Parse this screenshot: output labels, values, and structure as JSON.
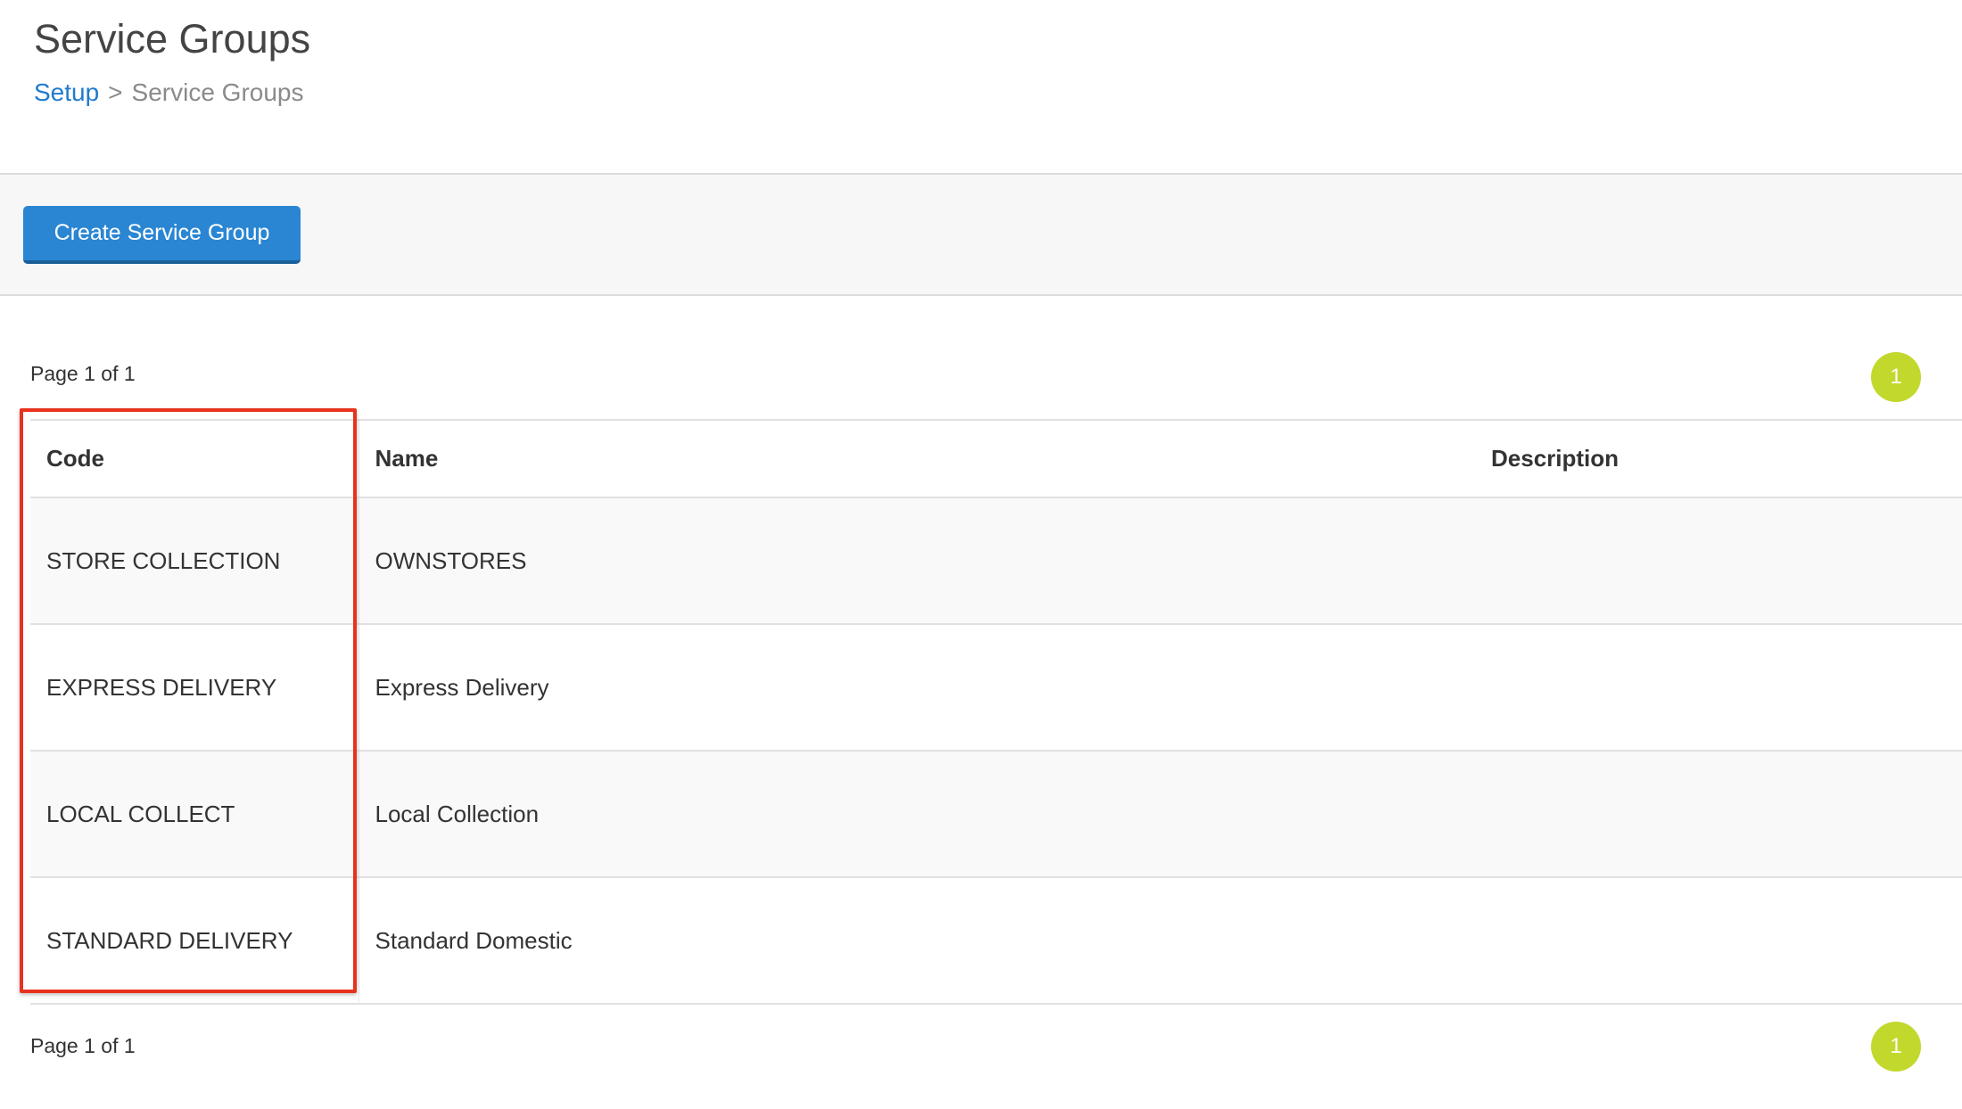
{
  "header": {
    "title": "Service Groups",
    "breadcrumb": {
      "root": "Setup",
      "separator": ">",
      "current": "Service Groups"
    }
  },
  "toolbar": {
    "create_label": "Create Service Group"
  },
  "pagination": {
    "label": "Page 1 of 1",
    "current_page": "1"
  },
  "table": {
    "columns": {
      "code": "Code",
      "name": "Name",
      "description": "Description"
    },
    "rows": [
      {
        "code": "STORE COLLECTION",
        "name": "OWNSTORES",
        "description": ""
      },
      {
        "code": "EXPRESS DELIVERY",
        "name": "Express Delivery",
        "description": ""
      },
      {
        "code": "LOCAL COLLECT",
        "name": "Local Collection",
        "description": ""
      },
      {
        "code": "STANDARD DELIVERY",
        "name": "Standard Domestic",
        "description": ""
      }
    ]
  },
  "colors": {
    "primary_button": "#2a86d3",
    "page_badge": "#c3d82c",
    "highlight": "#e8321e",
    "link": "#1f7bcc"
  }
}
